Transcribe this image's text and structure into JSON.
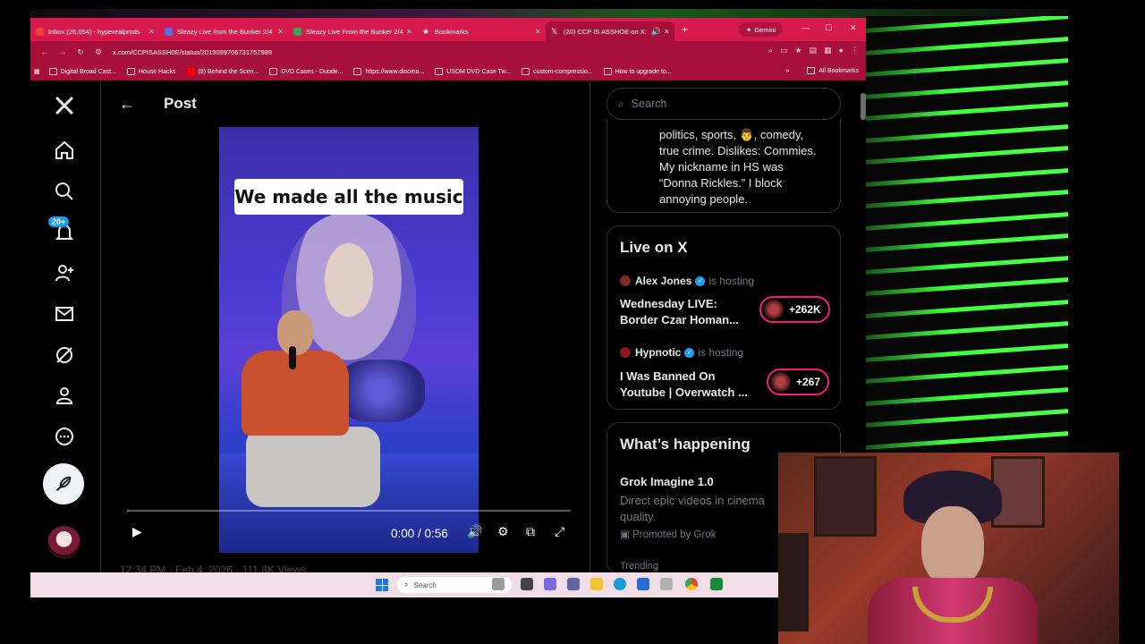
{
  "browser": {
    "tabs": [
      {
        "label": "Inbox (26,054) - hyperealprods",
        "color": "#ea4335",
        "active": false
      },
      {
        "label": "Sleazy Live from the Bunker 2/4",
        "color": "#5b6ee1",
        "active": false
      },
      {
        "label": "Sleazy Live From the Bunker 2/4",
        "color": "#34a853",
        "active": false
      },
      {
        "label": "Bookmarks",
        "color": "#ffffff",
        "active": false
      },
      {
        "label": "(20) CCP IS ASSHOE on X:",
        "color": "#000000",
        "active": true
      }
    ],
    "new_tab_symbol": "+",
    "gemini_label": "Gemini",
    "url": "x.com/CCPISASSH0E/status/2019099706731757989",
    "bookmarks": [
      "Digital Broad Cast...",
      "House Hacks",
      "(8) Behind the Scen...",
      "DVD Cases - Duode...",
      "https://www.discma...",
      "USDM DVD Case Tw...",
      "custom-compressio...",
      "How to upgrade to..."
    ],
    "all_bookmarks_label": "All Bookmarks"
  },
  "x": {
    "notification_badge": "20+",
    "header": {
      "title": "Post"
    },
    "video": {
      "caption": "We made all the music",
      "time": "0:00 / 0:56",
      "progress": 0.0
    },
    "post_meta": "12:34 PM · Feb 4, 2026 · 111.8K Views",
    "search_placeholder": "Search",
    "bio_lines": [
      "politics, sports, 👨, comedy,",
      "true crime. Dislikes: Commies.",
      "My nickname in HS was",
      "“Donna Rickles.” I block",
      "annoying people."
    ],
    "live": {
      "title": "Live on X",
      "spaces": [
        {
          "host": "Alex Jones",
          "action": "is hosting",
          "title_line1": "Wednesday LIVE:",
          "title_line2": "Border Czar Homan...",
          "listeners": "+262K"
        },
        {
          "host": "Hypnotic",
          "action": "is hosting",
          "title_line1": "I Was Banned On",
          "title_line2": "Youtube | Overwatch ...",
          "listeners": "+267"
        }
      ]
    },
    "happening": {
      "title": "What’s happening",
      "trend_title": "Grok Imagine 1.0",
      "trend_desc_line1": "Direct epic videos in cinema",
      "trend_desc_line2": "quality.",
      "promoted": "Promoted by Grok",
      "trending_label": "Trending"
    }
  },
  "taskbar": {
    "search_placeholder": "Search"
  },
  "colors": {
    "accent": "#1d9bf0",
    "live_pink": "#f91880",
    "chrome_red": "#d61a4d"
  }
}
